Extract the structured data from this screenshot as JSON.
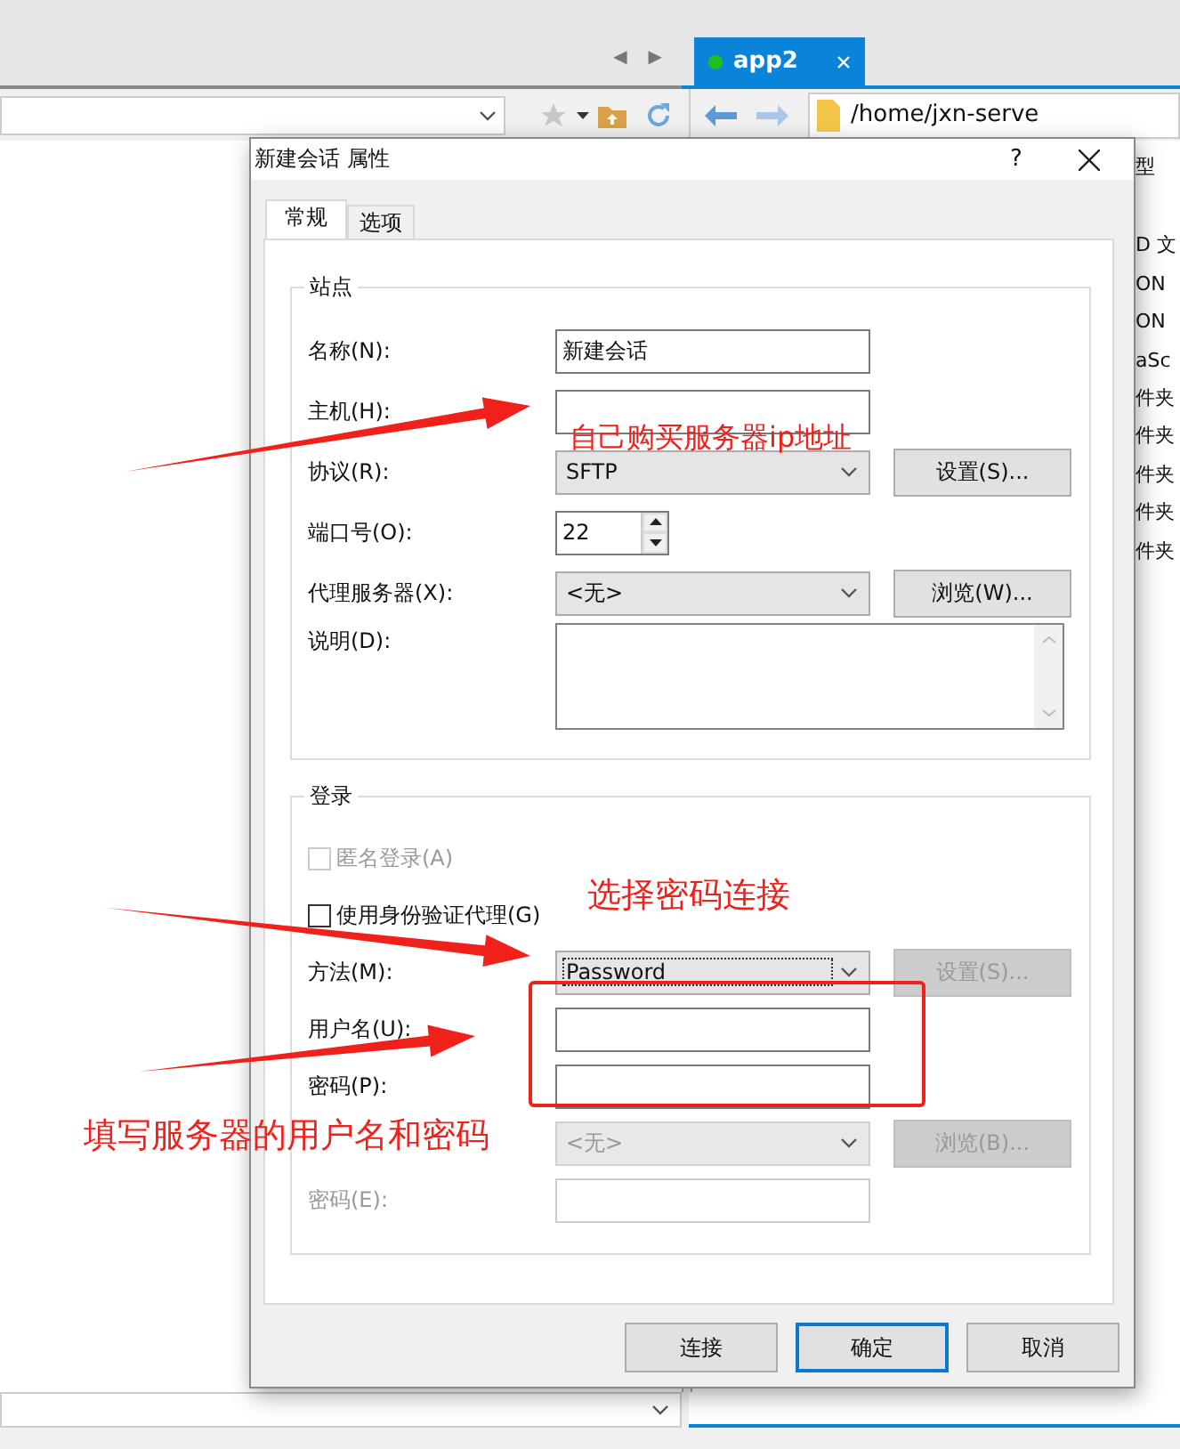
{
  "background": {
    "nav_arrows": [
      "◀",
      "▶"
    ],
    "tabs": [
      {
        "label": "app2",
        "selected": true,
        "connected": true
      }
    ],
    "right_path": "/home/jxn-serve",
    "type_column": [
      "型",
      "D 文",
      "ON",
      "ON",
      "aSc",
      "件夹",
      "件夹",
      "件夹",
      "件夹",
      "件夹"
    ]
  },
  "dialog": {
    "title": "新建会话 属性",
    "help": "?",
    "tabs": [
      {
        "label": "常规",
        "selected": true
      },
      {
        "label": "选项",
        "selected": false
      }
    ],
    "groups": [
      {
        "title": "站点",
        "rows": [
          {
            "kind": "text",
            "label": "名称(N):",
            "value": "新建会话",
            "disabled": false
          },
          {
            "kind": "text",
            "label": "主机(H):",
            "disabled": false
          },
          {
            "kind": "select",
            "label": "协议(R):",
            "value": "SFTP",
            "button": "设置(S)...",
            "disabled": false,
            "button_disabled": false,
            "focused": false
          },
          {
            "kind": "spinner",
            "label": "端口号(O):",
            "value": "22"
          },
          {
            "kind": "select",
            "label": "代理服务器(X):",
            "value": "<无>",
            "button": "浏览(W)...",
            "disabled": false,
            "button_disabled": false,
            "focused": false
          },
          {
            "kind": "textarea",
            "label": "说明(D):"
          }
        ]
      },
      {
        "title": "登录",
        "rows": [
          {
            "kind": "checkbox",
            "label": "匿名登录(A)",
            "checked": false,
            "disabled": true
          },
          {
            "kind": "checkbox",
            "label": "使用身份验证代理(G)",
            "checked": false,
            "disabled": false
          },
          {
            "kind": "select",
            "label": "方法(M):",
            "value": "Password",
            "button": "设置(S)...",
            "disabled": false,
            "button_disabled": true,
            "focused": true
          },
          {
            "kind": "text",
            "label": "用户名(U):",
            "disabled": false
          },
          {
            "kind": "text",
            "label": "密码(P):",
            "disabled": false
          },
          {
            "kind": "select",
            "value": "<无>",
            "button": "浏览(B)...",
            "disabled": true,
            "button_disabled": true,
            "focused": false
          },
          {
            "kind": "text",
            "label": "密码(E):",
            "disabled": true
          }
        ]
      }
    ],
    "buttons": [
      {
        "label": "连接",
        "default": false
      },
      {
        "label": "确定",
        "default": true
      },
      {
        "label": "取消",
        "default": false
      }
    ]
  },
  "annotations": [
    "自己购买服务器ip地址",
    "选择密码连接",
    "填写服务器的用户名和密码"
  ]
}
